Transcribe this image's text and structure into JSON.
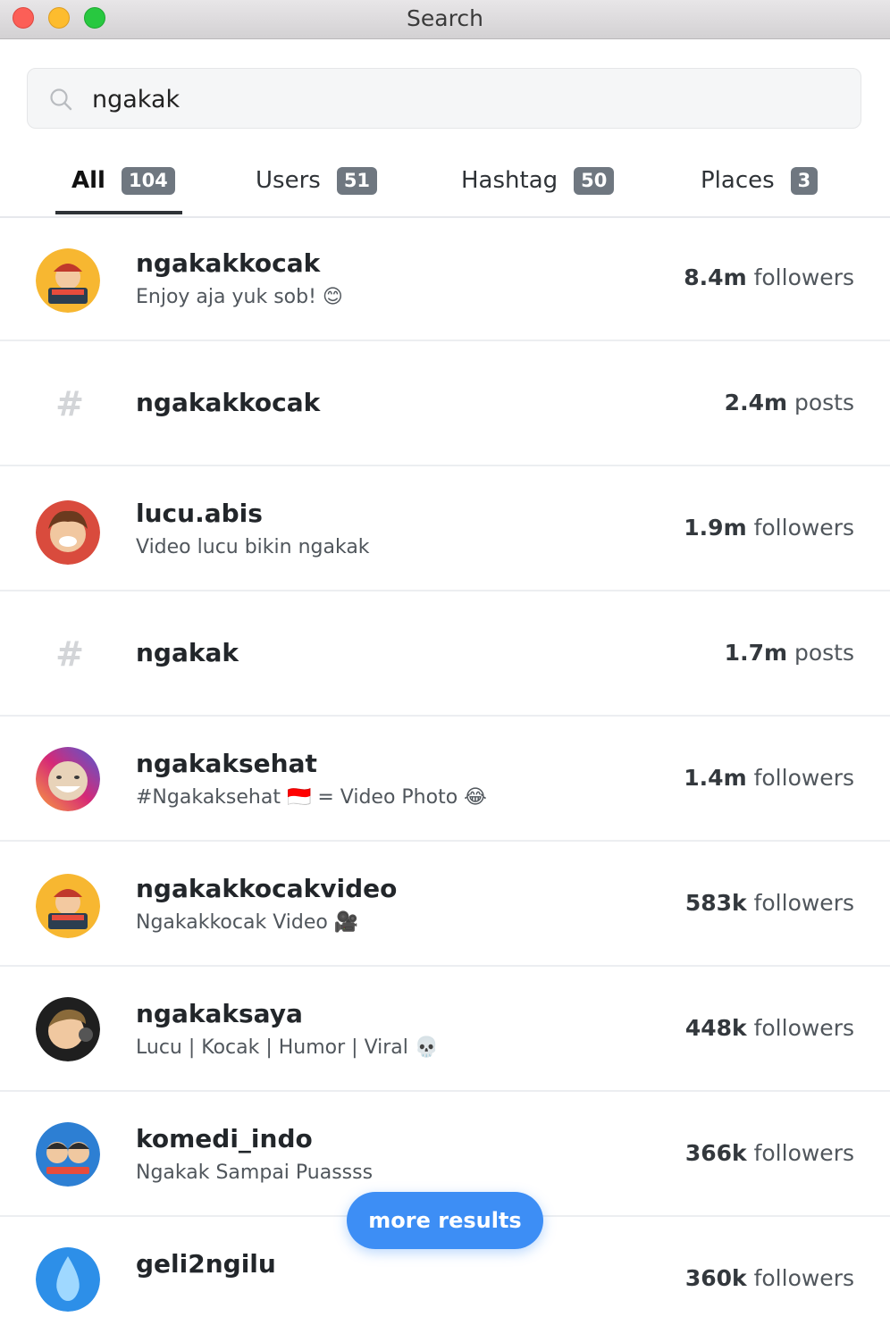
{
  "window": {
    "title": "Search"
  },
  "search": {
    "value": "ngakak",
    "placeholder": ""
  },
  "tabs": [
    {
      "label": "All",
      "count": "104",
      "active": true
    },
    {
      "label": "Users",
      "count": "51"
    },
    {
      "label": "Hashtag",
      "count": "50"
    },
    {
      "label": "Places",
      "count": "3"
    }
  ],
  "results": [
    {
      "type": "user",
      "name": "ngakakkocak",
      "bio": "Enjoy aja yuk sob! 😊",
      "stat_value": "8.4m",
      "stat_unit": "followers",
      "avatar_color": "#f7b731"
    },
    {
      "type": "hashtag",
      "name": "ngakakkocak",
      "stat_value": "2.4m",
      "stat_unit": "posts",
      "icon": "#"
    },
    {
      "type": "user",
      "name": "lucu.abis",
      "bio": "Video lucu bikin ngakak",
      "stat_value": "1.9m",
      "stat_unit": "followers",
      "avatar_color": "#d94b3d"
    },
    {
      "type": "hashtag",
      "name": "ngakak",
      "stat_value": "1.7m",
      "stat_unit": "posts",
      "icon": "#"
    },
    {
      "type": "user",
      "name": "ngakaksehat",
      "bio": "#Ngakaksehat 🇮🇩 = Video Photo 😂",
      "stat_value": "1.4m",
      "stat_unit": "followers",
      "avatar_color": "#c13584"
    },
    {
      "type": "user",
      "name": "ngakakkocakvideo",
      "bio": "Ngakakkocak Video 🎥",
      "stat_value": "583k",
      "stat_unit": "followers",
      "avatar_color": "#f7b731"
    },
    {
      "type": "user",
      "name": "ngakaksaya",
      "bio": "Lucu | Kocak | Humor | Viral 💀",
      "stat_value": "448k",
      "stat_unit": "followers",
      "avatar_color": "#1f1f1f"
    },
    {
      "type": "user",
      "name": "komedi_indo",
      "bio": "Ngakak Sampai Puassss",
      "stat_value": "366k",
      "stat_unit": "followers",
      "avatar_color": "#2d7fd3"
    },
    {
      "type": "user",
      "name": "geli2ngilu",
      "bio": "",
      "stat_value": "360k",
      "stat_unit": "followers",
      "avatar_color": "#2d8fe8"
    }
  ],
  "more_button": {
    "label": "more results"
  }
}
